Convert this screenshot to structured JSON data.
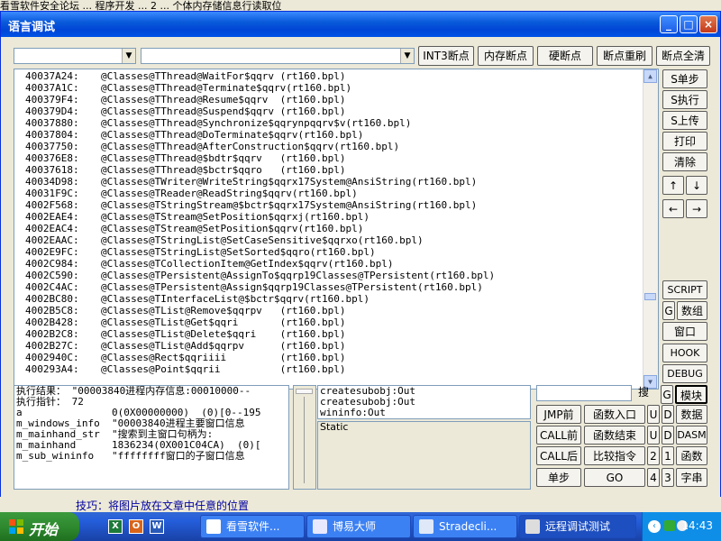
{
  "background": {
    "top_strip": "看雪软件安全论坛 ... 程序开发 ... 2 ... 个体内存储信息行读取位",
    "bottom_strip": "技巧：将图片放在文章中任意的位置"
  },
  "window": {
    "title": "语言调试"
  },
  "toolbar": {
    "combo1_value": "",
    "combo2_value": "",
    "buttons": [
      "INT3断点",
      "内存断点",
      "硬断点",
      "断点重刷",
      "断点全清"
    ]
  },
  "disasm": {
    "rows": [
      {
        "addr": "40037A24:",
        "text": "@Classes@TThread@WaitFor$qqrv (rt160.bpl)"
      },
      {
        "addr": "40037A1C:",
        "text": "@Classes@TThread@Terminate$qqrv(rt160.bpl)"
      },
      {
        "addr": "400379F4:",
        "text": "@Classes@TThread@Resume$qqrv  (rt160.bpl)"
      },
      {
        "addr": "400379D4:",
        "text": "@Classes@TThread@Suspend$qqrv (rt160.bpl)"
      },
      {
        "addr": "40037880:",
        "text": "@Classes@TThread@Synchronize$qqrynpqqrv$v(rt160.bpl)"
      },
      {
        "addr": "40037804:",
        "text": "@Classes@TThread@DoTerminate$qqrv(rt160.bpl)"
      },
      {
        "addr": "40037750:",
        "text": "@Classes@TThread@AfterConstruction$qqrv(rt160.bpl)"
      },
      {
        "addr": "400376E8:",
        "text": "@Classes@TThread@$bdtr$qqrv   (rt160.bpl)"
      },
      {
        "addr": "40037618:",
        "text": "@Classes@TThread@$bctr$qqro   (rt160.bpl)"
      },
      {
        "addr": "40034D98:",
        "text": "@Classes@TWriter@WriteString$qqrx17System@AnsiString(rt160.bpl)"
      },
      {
        "addr": "40031F9C:",
        "text": "@Classes@TReader@ReadString$qqrv(rt160.bpl)"
      },
      {
        "addr": "4002F568:",
        "text": "@Classes@TStringStream@$bctr$qqrx17System@AnsiString(rt160.bpl)"
      },
      {
        "addr": "4002EAE4:",
        "text": "@Classes@TStream@SetPosition$qqrxj(rt160.bpl)"
      },
      {
        "addr": "4002EAC4:",
        "text": "@Classes@TStream@SetPosition$qqrv(rt160.bpl)"
      },
      {
        "addr": "4002EAAC:",
        "text": "@Classes@TStringList@SetCaseSensitive$qqrxo(rt160.bpl)"
      },
      {
        "addr": "4002E9FC:",
        "text": "@Classes@TStringList@SetSorted$qqro(rt160.bpl)"
      },
      {
        "addr": "4002C984:",
        "text": "@Classes@TCollectionItem@GetIndex$qqrv(rt160.bpl)"
      },
      {
        "addr": "4002C590:",
        "text": "@Classes@TPersistent@AssignTo$qqrp19Classes@TPersistent(rt160.bpl)"
      },
      {
        "addr": "4002C4AC:",
        "text": "@Classes@TPersistent@Assign$qqrp19Classes@TPersistent(rt160.bpl)"
      },
      {
        "addr": "4002BC80:",
        "text": "@Classes@TInterfaceList@$bctr$qqrv(rt160.bpl)"
      },
      {
        "addr": "4002B5C8:",
        "text": "@Classes@TList@Remove$qqrpv   (rt160.bpl)"
      },
      {
        "addr": "4002B428:",
        "text": "@Classes@TList@Get$qqri       (rt160.bpl)"
      },
      {
        "addr": "4002B2C8:",
        "text": "@Classes@TList@Delete$qqri    (rt160.bpl)"
      },
      {
        "addr": "4002B27C:",
        "text": "@Classes@TList@Add$qqrpv      (rt160.bpl)"
      },
      {
        "addr": "4002940C:",
        "text": "@Classes@Rect$qqriiii         (rt160.bpl)"
      },
      {
        "addr": "400293A4:",
        "text": "@Classes@Point$qqrii          (rt160.bpl)"
      }
    ]
  },
  "side_buttons": {
    "step": "S单步",
    "exec": "S执行",
    "upload": "S上传",
    "print": "打印",
    "clear": "清除",
    "up": "↑",
    "down": "↓",
    "left": "←",
    "right": "→",
    "script": "SCRIPT",
    "g": "G",
    "array": "数组",
    "window": "窗口",
    "hook": "HOOK",
    "debug": "DEBUG"
  },
  "result": {
    "lines": [
      "执行结果： \"00003840进程内存信息:00010000--",
      "执行指针： 72",
      "a               0(0X00000000)  (0)[0--195",
      "m_windows_info  \"00003840进程主要窗口信息",
      "m_mainhand_str  \"搜索到主窗口句柄为:",
      "m_mainhand      1836234(0X001C04CA)  (0)[",
      "m_sub_wininfo   \"ffffffff窗口的子窗口信息"
    ]
  },
  "calls": {
    "lines": [
      "createsubobj:Out",
      "createsubobj:Out",
      "wininfo:Out"
    ]
  },
  "static_label": "Static",
  "search": {
    "value": "",
    "button": "搜"
  },
  "bottom_right": {
    "g": "G",
    "module": "模块",
    "jmp_prev": "JMP前",
    "func_entry": "函数入口",
    "u1": "U",
    "d1": "D",
    "data": "数据",
    "call_prev": "CALL前",
    "func_end": "函数结束",
    "u2": "U",
    "d2": "D",
    "dasm": "DASM",
    "call_next": "CALL后",
    "compare": "比较指令",
    "n2": "2",
    "n1": "1",
    "func": "函数",
    "single_step": "单步",
    "go": "GO",
    "n4": "4",
    "n3": "3",
    "str": "字串"
  },
  "taskbar": {
    "start": "开始",
    "quicklaunch": [
      "X",
      "O",
      "W"
    ],
    "tasks": [
      "看雪软件...",
      "博易大师",
      "Stradecli...",
      "远程调试测试"
    ],
    "clock": "14:43"
  }
}
